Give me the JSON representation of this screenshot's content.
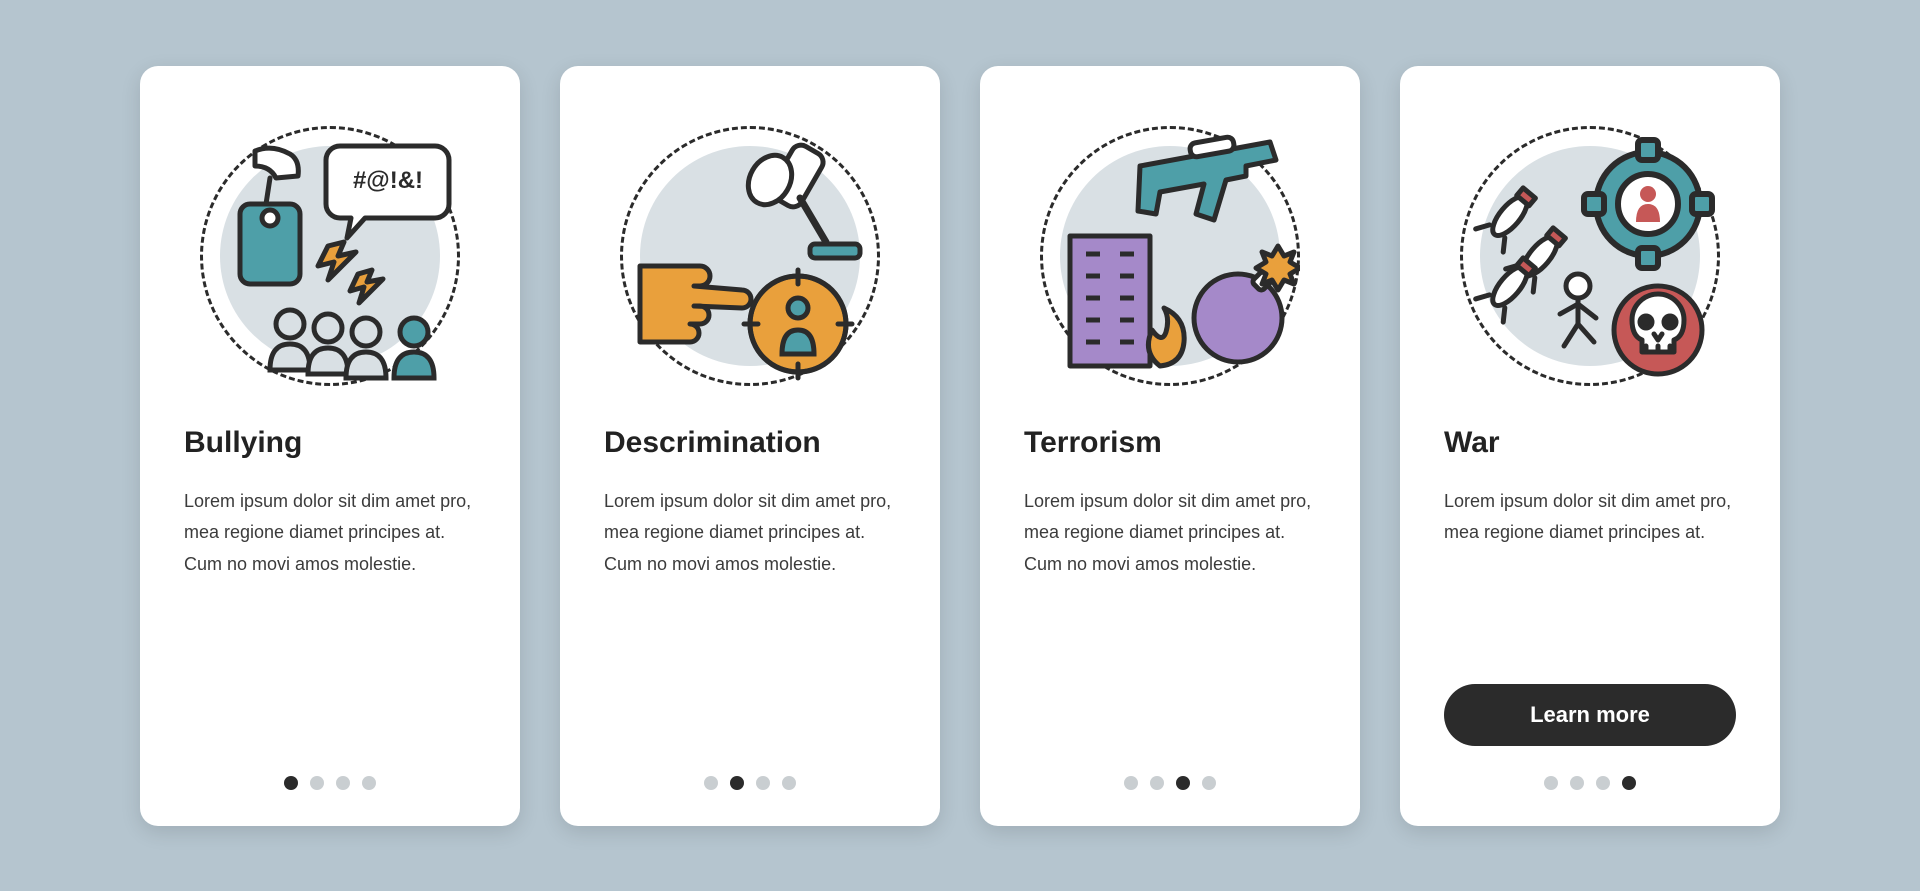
{
  "colors": {
    "background": "#b5c5cf",
    "cardBg": "#ffffff",
    "text": "#3b3b3b",
    "heading": "#222222",
    "accentTeal": "#4e9fa8",
    "accentOrange": "#e9a03c",
    "accentPurple": "#a589c9",
    "accentRed": "#c65857",
    "iconStroke": "#2b2b2b",
    "dotInactive": "#c9ced1",
    "dotActive": "#2b2b2b",
    "buttonBg": "#2b2b2b",
    "buttonText": "#ffffff"
  },
  "cards": [
    {
      "title": "Bullying",
      "body": "Lorem ipsum dolor sit dim amet pro, mea regione diamet principes at. Cum no movi amos molestie.",
      "activeDot": 0,
      "iconName": "bullying-icon"
    },
    {
      "title": "Descrimination",
      "body": "Lorem ipsum dolor sit dim amet pro, mea regione diamet principes at. Cum no movi amos molestie.",
      "activeDot": 1,
      "iconName": "discrimination-icon"
    },
    {
      "title": "Terrorism",
      "body": "Lorem ipsum dolor sit dim amet pro, mea regione diamet principes at. Cum no movi amos molestie.",
      "activeDot": 2,
      "iconName": "terrorism-icon"
    },
    {
      "title": "War",
      "body": "Lorem ipsum dolor sit dim amet pro, mea regione diamet principes at.",
      "activeDot": 3,
      "iconName": "war-icon",
      "button": "Learn more"
    }
  ],
  "dotsCount": 4
}
